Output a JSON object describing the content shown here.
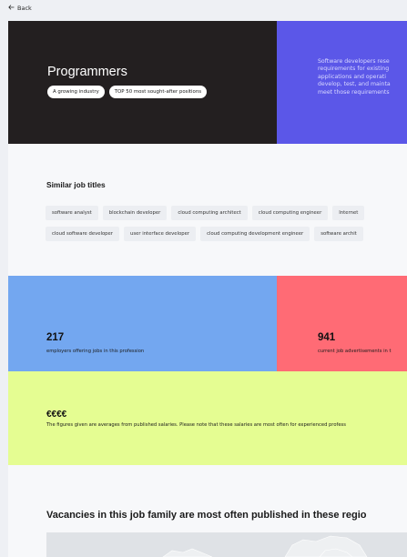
{
  "nav": {
    "back_icon": "arrow-left-icon",
    "back_label": "Back"
  },
  "hero": {
    "title": "Programmers",
    "tags": [
      "A growing industry",
      "TOP 50 most sought-after positions"
    ],
    "description_lines": [
      "Software developers rese",
      "requirements for existing",
      "applications and operati",
      "develop, test, and mainta",
      "meet those requirements"
    ],
    "colors": {
      "left": "#231f20",
      "right": "#5b57e8"
    }
  },
  "similar": {
    "heading": "Similar job titles",
    "row1": [
      "software analyst",
      "blockchain developer",
      "cloud computing architect",
      "cloud computing engineer",
      "Internet"
    ],
    "row2": [
      "cloud software developer",
      "user interface developer",
      "cloud computing development engineer",
      "software archit"
    ]
  },
  "stats": {
    "employers": {
      "value": "217",
      "label": "employers offering jobs in this profession",
      "color": "#73a7f0"
    },
    "adverts": {
      "value": "941",
      "label": "current job advertisements in t",
      "color": "#ff6b75"
    }
  },
  "salary": {
    "level": "€€€€",
    "note": "The figures given are averages from published salaries. Please note that these salaries are most often for experienced profess",
    "color": "#e5fd92"
  },
  "vacancies": {
    "heading": "Vacancies in this job family are most often published in these regio"
  }
}
